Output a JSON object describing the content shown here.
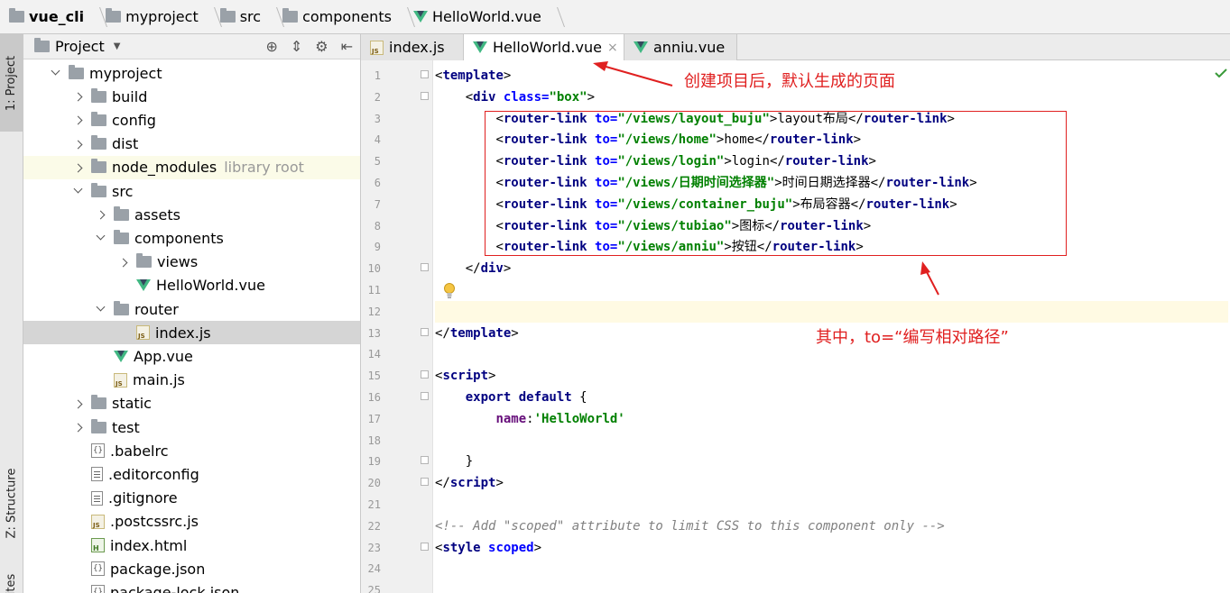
{
  "breadcrumb": [
    {
      "label": "vue_cli",
      "icon": "folder-icon"
    },
    {
      "label": "myproject",
      "icon": "folder-icon"
    },
    {
      "label": "src",
      "icon": "folder-icon"
    },
    {
      "label": "components",
      "icon": "folder-icon"
    },
    {
      "label": "HelloWorld.vue",
      "icon": "vue-file-icon"
    }
  ],
  "tool_strip": {
    "project_tab": "1: Project",
    "structure_tab": "Z: Structure",
    "favorites_tab": "ites"
  },
  "project_panel": {
    "title": "Project",
    "tree": [
      {
        "label": "myproject",
        "icon": "folder-icon",
        "state": "expanded",
        "depth": 0
      },
      {
        "label": "build",
        "icon": "folder-icon",
        "state": "collapsed",
        "depth": 1
      },
      {
        "label": "config",
        "icon": "folder-icon",
        "state": "collapsed",
        "depth": 1
      },
      {
        "label": "dist",
        "icon": "folder-icon",
        "state": "collapsed",
        "depth": 1
      },
      {
        "label": "node_modules",
        "tag": "library root",
        "icon": "folder-icon",
        "state": "collapsed",
        "depth": 1
      },
      {
        "label": "src",
        "icon": "folder-icon",
        "state": "expanded",
        "depth": 1
      },
      {
        "label": "assets",
        "icon": "folder-icon",
        "state": "collapsed",
        "depth": 2
      },
      {
        "label": "components",
        "icon": "folder-icon",
        "state": "expanded",
        "depth": 2
      },
      {
        "label": "views",
        "icon": "folder-icon",
        "state": "collapsed",
        "depth": 3
      },
      {
        "label": "HelloWorld.vue",
        "icon": "vue-file-icon",
        "state": "leaf",
        "depth": 3
      },
      {
        "label": "router",
        "icon": "folder-icon",
        "state": "expanded",
        "depth": 2
      },
      {
        "label": "index.js",
        "icon": "js-file-icon",
        "state": "leaf",
        "depth": 3,
        "selected": true
      },
      {
        "label": "App.vue",
        "icon": "vue-file-icon",
        "state": "leaf",
        "depth": 2
      },
      {
        "label": "main.js",
        "icon": "js-file-icon",
        "state": "leaf",
        "depth": 2
      },
      {
        "label": "static",
        "icon": "folder-icon",
        "state": "collapsed",
        "depth": 1
      },
      {
        "label": "test",
        "icon": "folder-icon",
        "state": "collapsed",
        "depth": 1
      },
      {
        "label": ".babelrc",
        "icon": "json-file-icon",
        "state": "leaf",
        "depth": 1
      },
      {
        "label": ".editorconfig",
        "icon": "text-file-icon",
        "state": "leaf",
        "depth": 1
      },
      {
        "label": ".gitignore",
        "icon": "text-file-icon",
        "state": "leaf",
        "depth": 1
      },
      {
        "label": ".postcssrc.js",
        "icon": "js-file-icon",
        "state": "leaf",
        "depth": 1
      },
      {
        "label": "index.html",
        "icon": "html-file-icon",
        "state": "leaf",
        "depth": 1
      },
      {
        "label": "package.json",
        "icon": "json-file-icon",
        "state": "leaf",
        "depth": 1
      },
      {
        "label": "package-lock.json",
        "icon": "json-file-icon",
        "state": "leaf",
        "depth": 1
      }
    ]
  },
  "editor_tabs": [
    {
      "label": "index.js",
      "icon": "js-file-icon",
      "active": false
    },
    {
      "label": "HelloWorld.vue",
      "icon": "vue-file-icon",
      "active": true,
      "close": "×"
    },
    {
      "label": "anniu.vue",
      "icon": "vue-file-icon",
      "active": false
    }
  ],
  "code_lines": [
    {
      "n": "1",
      "html": "<span class=\"br\">&lt;</span><span class=\"tag\">template</span><span class=\"br\">&gt;</span>"
    },
    {
      "n": "2",
      "html": "    <span class=\"br\">&lt;</span><span class=\"tag\">div </span><span class=\"attr\">class=</span><span class=\"str\">\"box\"</span><span class=\"br\">&gt;</span>"
    },
    {
      "n": "3",
      "html": "        <span class=\"br\">&lt;</span><span class=\"tag\">router-link </span><span class=\"attr\">to=</span><span class=\"str\">\"/views/layout_buju\"</span><span class=\"br\">&gt;</span><span class=\"txt\">layout布局</span><span class=\"br\">&lt;/</span><span class=\"tag\">router-link</span><span class=\"br\">&gt;</span>"
    },
    {
      "n": "4",
      "html": "        <span class=\"br\">&lt;</span><span class=\"tag\">router-link </span><span class=\"attr\">to=</span><span class=\"str\">\"/views/home\"</span><span class=\"br\">&gt;</span><span class=\"txt\">home</span><span class=\"br\">&lt;/</span><span class=\"tag\">router-link</span><span class=\"br\">&gt;</span>"
    },
    {
      "n": "5",
      "html": "        <span class=\"br\">&lt;</span><span class=\"tag\">router-link </span><span class=\"attr\">to=</span><span class=\"str\">\"/views/login\"</span><span class=\"br\">&gt;</span><span class=\"txt\">login</span><span class=\"br\">&lt;/</span><span class=\"tag\">router-link</span><span class=\"br\">&gt;</span>"
    },
    {
      "n": "6",
      "html": "        <span class=\"br\">&lt;</span><span class=\"tag\">router-link </span><span class=\"attr\">to=</span><span class=\"str\">\"/views/日期时间选择器\"</span><span class=\"br\">&gt;</span><span class=\"txt\">时间日期选择器</span><span class=\"br\">&lt;/</span><span class=\"tag\">router-link</span><span class=\"br\">&gt;</span>"
    },
    {
      "n": "7",
      "html": "        <span class=\"br\">&lt;</span><span class=\"tag\">router-link </span><span class=\"attr\">to=</span><span class=\"str\">\"/views/container_buju\"</span><span class=\"br\">&gt;</span><span class=\"txt\">布局容器</span><span class=\"br\">&lt;/</span><span class=\"tag\">router-link</span><span class=\"br\">&gt;</span>"
    },
    {
      "n": "8",
      "html": "        <span class=\"br\">&lt;</span><span class=\"tag\">router-link </span><span class=\"attr\">to=</span><span class=\"str\">\"/views/tubiao\"</span><span class=\"br\">&gt;</span><span class=\"txt\">图标</span><span class=\"br\">&lt;/</span><span class=\"tag\">router-link</span><span class=\"br\">&gt;</span>"
    },
    {
      "n": "9",
      "html": "        <span class=\"br\">&lt;</span><span class=\"tag\">router-link </span><span class=\"attr\">to=</span><span class=\"str\">\"/views/anniu\"</span><span class=\"br\">&gt;</span><span class=\"txt\">按钮</span><span class=\"br\">&lt;/</span><span class=\"tag\">router-link</span><span class=\"br\">&gt;</span>"
    },
    {
      "n": "10",
      "html": "    <span class=\"br\">&lt;/</span><span class=\"tag\">div</span><span class=\"br\">&gt;</span>"
    },
    {
      "n": "11",
      "html": ""
    },
    {
      "n": "12",
      "html": "",
      "current": true
    },
    {
      "n": "13",
      "html": "<span class=\"br\">&lt;/</span><span class=\"tag\">template</span><span class=\"br\">&gt;</span>"
    },
    {
      "n": "14",
      "html": ""
    },
    {
      "n": "15",
      "html": "<span class=\"br\">&lt;</span><span class=\"tag\">script</span><span class=\"br\">&gt;</span>"
    },
    {
      "n": "16",
      "html": "    <span class=\"kw\">export default</span><span class=\"br\"> {</span>"
    },
    {
      "n": "17",
      "html": "        <span class=\"attr\" style=\"color:#660e7a\">name</span><span class=\"br\">:</span><span class=\"str\">'HelloWorld'</span>"
    },
    {
      "n": "18",
      "html": ""
    },
    {
      "n": "19",
      "html": "    <span class=\"br\">}</span>"
    },
    {
      "n": "20",
      "html": "<span class=\"br\">&lt;/</span><span class=\"tag\">script</span><span class=\"br\">&gt;</span>"
    },
    {
      "n": "21",
      "html": ""
    },
    {
      "n": "22",
      "html": "<span class=\"cmt\">&lt;!-- Add \"scoped\" attribute to limit CSS to this component only --&gt;</span>"
    },
    {
      "n": "23",
      "html": "<span class=\"br\">&lt;</span><span class=\"tag\">style </span><span class=\"attr\">scoped</span><span class=\"br\">&gt;</span>"
    },
    {
      "n": "24",
      "html": ""
    },
    {
      "n": "25",
      "html": ""
    }
  ],
  "annotations": {
    "top_note": "创建项目后，默认生成的页面",
    "bottom_note": "其中，to=“编写相对路径”",
    "color": "#e02020"
  }
}
